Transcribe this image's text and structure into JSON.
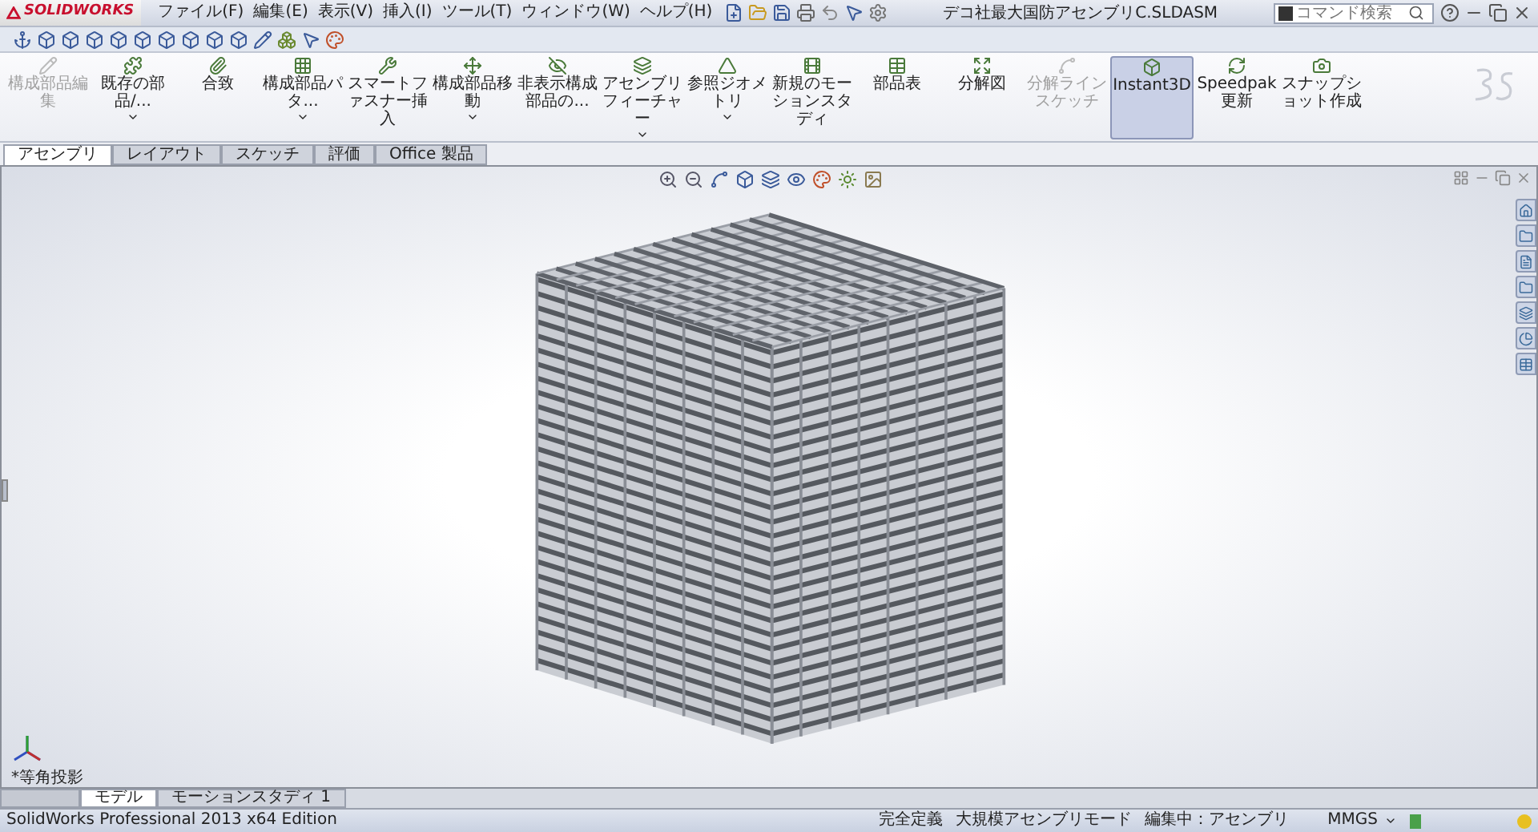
{
  "app": {
    "logo": "SOLIDWORKS"
  },
  "menu": [
    "ファイル(F)",
    "編集(E)",
    "表示(V)",
    "挿入(I)",
    "ツール(T)",
    "ウィンドウ(W)",
    "ヘルプ(H)"
  ],
  "window": {
    "title": "デコ社最大国防アセンブリC.SLDASM"
  },
  "search": {
    "placeholder": "コマンド検索"
  },
  "ribbon": [
    {
      "label": "構成部品編集",
      "selected": false,
      "disabled": true,
      "dropdown": false
    },
    {
      "label": "既存の部品/...",
      "selected": false,
      "disabled": false,
      "dropdown": true
    },
    {
      "label": "合致",
      "selected": false,
      "disabled": false,
      "dropdown": false
    },
    {
      "label": "構成部品パタ...",
      "selected": false,
      "disabled": false,
      "dropdown": true
    },
    {
      "label": "スマートファスナー挿入",
      "selected": false,
      "disabled": false,
      "dropdown": false
    },
    {
      "label": "構成部品移動",
      "selected": false,
      "disabled": false,
      "dropdown": true
    },
    {
      "label": "非表示構成部品の...",
      "selected": false,
      "disabled": false,
      "dropdown": false
    },
    {
      "label": "アセンブリフィーチャー",
      "selected": false,
      "disabled": false,
      "dropdown": true
    },
    {
      "label": "参照ジオメトリ",
      "selected": false,
      "disabled": false,
      "dropdown": true
    },
    {
      "label": "新規のモーションスタディ",
      "selected": false,
      "disabled": false,
      "dropdown": false
    },
    {
      "label": "部品表",
      "selected": false,
      "disabled": false,
      "dropdown": false
    },
    {
      "label": "分解図",
      "selected": false,
      "disabled": false,
      "dropdown": false
    },
    {
      "label": "分解ラインスケッチ",
      "selected": false,
      "disabled": true,
      "dropdown": false
    },
    {
      "label": "Instant3D",
      "selected": true,
      "disabled": false,
      "dropdown": false
    },
    {
      "label": "Speedpak 更新",
      "selected": false,
      "disabled": false,
      "dropdown": false
    },
    {
      "label": "スナップショット作成",
      "selected": false,
      "disabled": false,
      "dropdown": false
    }
  ],
  "tabs": [
    {
      "label": "アセンブリ",
      "selected": true
    },
    {
      "label": "レイアウト",
      "selected": false
    },
    {
      "label": "スケッチ",
      "selected": false
    },
    {
      "label": "評価",
      "selected": false
    },
    {
      "label": "Office 製品",
      "selected": false
    }
  ],
  "viewport": {
    "view_label": "*等角投影"
  },
  "bottom_tabs": [
    {
      "label": "モデル",
      "selected": true
    },
    {
      "label": "モーションスタディ 1",
      "selected": false
    }
  ],
  "status_bar": {
    "edition": "SolidWorks Professional 2013 x64 Edition",
    "items": [
      "完全定義",
      "大規模アセンブリモード",
      "編集中：アセンブリ"
    ],
    "units": "MMGS"
  }
}
